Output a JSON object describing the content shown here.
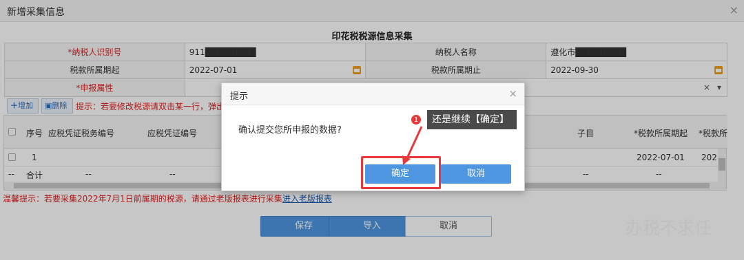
{
  "window": {
    "title": "新增采集信息",
    "close": "×"
  },
  "form": {
    "title": "印花税税源信息采集",
    "fields": {
      "taxpayer_id_label": "*纳税人识别号",
      "taxpayer_id_value": "911████████",
      "taxpayer_name_label": "纳税人名称",
      "taxpayer_name_value": "遵化市████████",
      "period_start_label": "税款所属期起",
      "period_start_value": "2022-07-01",
      "period_end_label": "税款所属期止",
      "period_end_value": "2022-09-30",
      "declare_attr_label": "*申报属性",
      "clear": "×",
      "dropdown": "▾"
    }
  },
  "toolbar": {
    "add_label": "增加",
    "delete_label": "删除",
    "hint": "提示：若要修改税源请双击某一行，弹出采"
  },
  "grid": {
    "headers": [
      "序号",
      "应税凭证税务编号",
      "应税凭证编号",
      "子目",
      "*税款所属期起",
      "*税款所"
    ],
    "row": {
      "seq": "1",
      "period_start": "2022-07-01",
      "period_partial": "202"
    },
    "total": {
      "dash": "--",
      "label": "合计",
      "c1": "--",
      "c2": "--",
      "c3": "--",
      "c4": "--"
    }
  },
  "warm_tip": {
    "text": "温馨提示：若要采集2022年7月1日前属期的税源，请通过老版报表进行采集",
    "link": "进入老版报表"
  },
  "buttons": {
    "save": "保存",
    "import": "导入",
    "cancel": "取消"
  },
  "dialog": {
    "title": "提示",
    "close": "×",
    "message": "确认提交您所申报的数据?",
    "confirm": "确定",
    "cancel": "取消"
  },
  "annotation": {
    "badge": "1",
    "callout": "还是继续【确定】"
  },
  "watermark": "办税不求任",
  "colors": {
    "primary": "#4e97e0",
    "highlight": "#e8393a",
    "required": "#e02020"
  }
}
